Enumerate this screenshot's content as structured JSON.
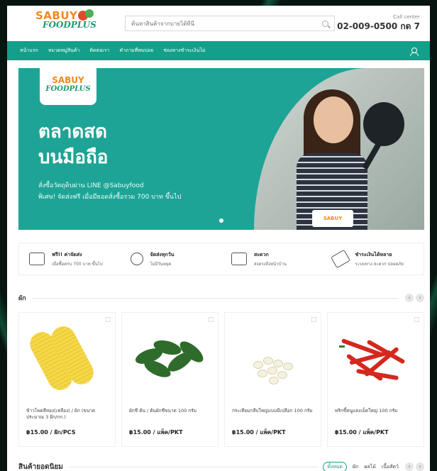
{
  "header": {
    "logo_line1": "SABUY",
    "logo_line2": "FOODPLUS",
    "search_placeholder": "ค้นหาสินค้าจากบายได้ที่นี่",
    "callcenter_label": "Call center",
    "callcenter_phone": "02-009-0500 กด 7"
  },
  "nav": {
    "items": [
      "หน้าแรก",
      "หมวดหมู่สินค้า",
      "ติดต่อเรา",
      "คำถามที่พบบ่อย",
      "ช่องทางชำระเงินไม่"
    ]
  },
  "banner": {
    "logo_line1": "SABUY",
    "logo_line2": "FOODPLUS",
    "headline_1": "ตลาดสด",
    "headline_2": "บนมือถือ",
    "sub_1": "สั่งซื้อวัตถุดิบผ่าน LINE  @Sabuyfood",
    "sub_2": "พิเศษ! จัดส่งฟรี เมื่อมียอดสั่งซื้อรวม 700 บาท ขึ้นไป",
    "apron_logo": "SABUY"
  },
  "features": [
    {
      "title": "ฟรี!! ค่าจัดส่ง",
      "sub": "เมื่อซื้อครบ 700 บาท ขึ้นไป",
      "icon": "truck-icon"
    },
    {
      "title": "จัดส่งทุกวัน",
      "sub": "ไม่มีวันหยุด",
      "icon": "globe-icon"
    },
    {
      "title": "สะดวก",
      "sub": "ส่งตรงถึงหน้าบ้าน",
      "icon": "register-icon"
    },
    {
      "title": "ชำระเงินได้หลาย",
      "sub": "ระบบทาง สะดวก ปลอดภัย",
      "icon": "tag-icon"
    }
  ],
  "section_veg": {
    "title": "ผัก",
    "prev": "‹",
    "next": "›"
  },
  "products": [
    {
      "name": "ข้าวโพดสีทอง(เหลือง) / ฝัก (ขนาดประมาณ 3 ฝัก/กก.)",
      "price": "฿15.00 / ฝัก/PCS"
    },
    {
      "name": "ผักชี ต้น / ต้นผักชีขนาด 100 กรัม",
      "price": "฿15.00 / แพ็ค/PKT"
    },
    {
      "name": "กระเทียมกลีบใหญ่แบบมีเปลือก 100 กรัม",
      "price": "฿15.00 / แพ็ค/PKT"
    },
    {
      "name": "พริกขี้หนูแดงเม็ดใหญ่ 100 กรัม",
      "price": "฿15.00 / แพ็ค/PKT"
    }
  ],
  "popular": {
    "title": "สินค้ายอดนิยม",
    "tabs": [
      "ทั้งหมด",
      "ผัก",
      "ผลไม้",
      "เนื้อสัตว์"
    ]
  },
  "colors": {
    "primary": "#12a08a",
    "banner": "#1ea496",
    "logo_orange": "#f08a1a"
  }
}
